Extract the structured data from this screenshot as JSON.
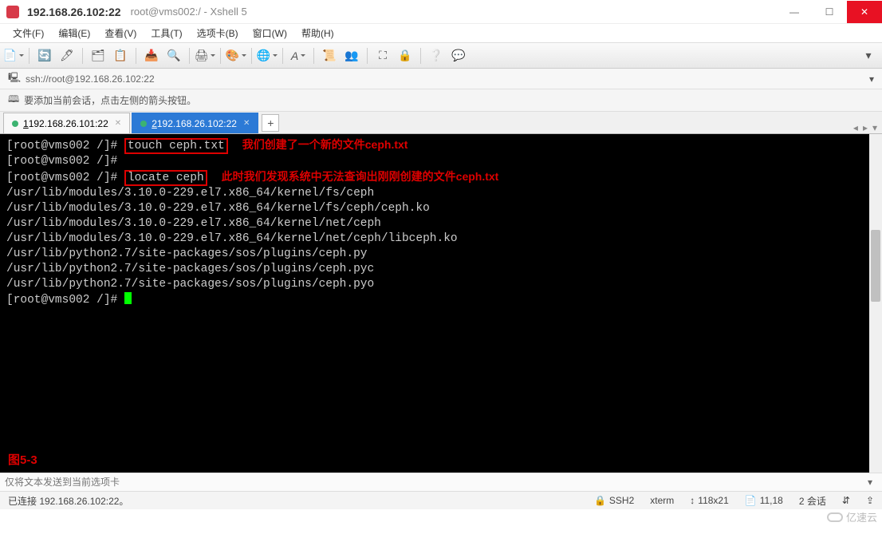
{
  "window": {
    "title_main": "192.168.26.102:22",
    "title_sub": "root@vms002:/ - Xshell 5"
  },
  "menus": {
    "file": "文件(F)",
    "edit": "编辑(E)",
    "view": "查看(V)",
    "tools": "工具(T)",
    "tabs": "选项卡(B)",
    "window": "窗口(W)",
    "help": "帮助(H)"
  },
  "address": {
    "scheme_icon": "🗔",
    "url": "ssh://root@192.168.26.102:22"
  },
  "infobar": {
    "text": "要添加当前会话，点击左侧的箭头按钮。"
  },
  "tabs": [
    {
      "underline": "1",
      "label": " 192.168.26.101:22",
      "active": false
    },
    {
      "underline": "2",
      "label": " 192.168.26.102:22",
      "active": true
    }
  ],
  "terminal": {
    "prompt": "[root@vms002 /]# ",
    "cmd1": "touch ceph.txt",
    "ann1": "我们创建了一个新的文件ceph.txt",
    "cmd2": "locate ceph",
    "ann2": "此时我们发现系统中无法查询出刚刚创建的文件ceph.txt",
    "out1": "/usr/lib/modules/3.10.0-229.el7.x86_64/kernel/fs/ceph",
    "out2": "/usr/lib/modules/3.10.0-229.el7.x86_64/kernel/fs/ceph/ceph.ko",
    "out3": "/usr/lib/modules/3.10.0-229.el7.x86_64/kernel/net/ceph",
    "out4": "/usr/lib/modules/3.10.0-229.el7.x86_64/kernel/net/ceph/libceph.ko",
    "out5": "/usr/lib/python2.7/site-packages/sos/plugins/ceph.py",
    "out6": "/usr/lib/python2.7/site-packages/sos/plugins/ceph.pyc",
    "out7": "/usr/lib/python2.7/site-packages/sos/plugins/ceph.pyo",
    "figure_label": "图5-3"
  },
  "sendbar": {
    "placeholder": "仅将文本发送到当前选项卡"
  },
  "status": {
    "conn": "已连接 192.168.26.102:22。",
    "proto": "SSH2",
    "term": "xterm",
    "size": "118x21",
    "cursor": "11,18",
    "sessions": "2 会话"
  },
  "watermark": {
    "text": "亿速云"
  },
  "icons": {
    "lock": "🔒",
    "doc": "📄",
    "size_pre": "↕",
    "sessions_arrows": "⇵",
    "caps": "⇪"
  }
}
